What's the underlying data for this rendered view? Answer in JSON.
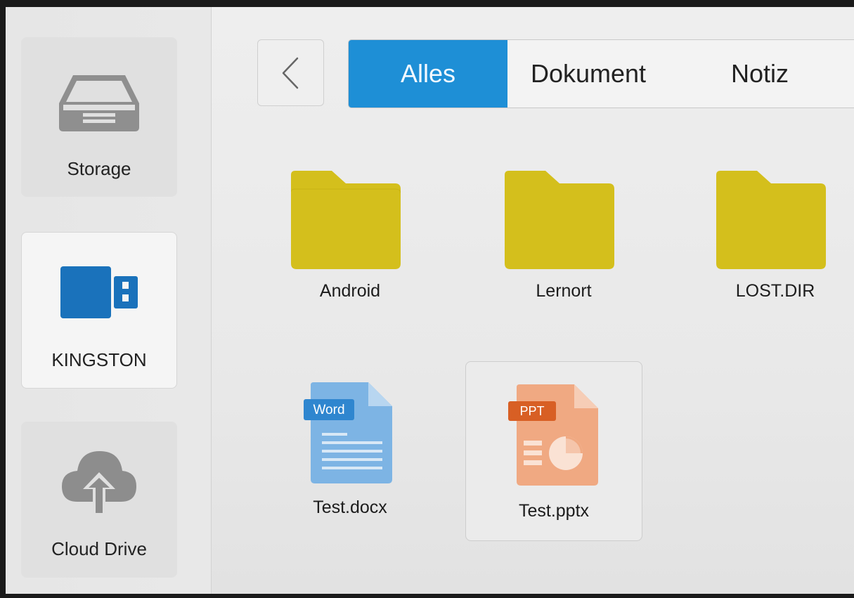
{
  "sidebar": {
    "items": [
      {
        "label": "Storage",
        "icon": "storage-tray-icon"
      },
      {
        "label": "KINGSTON",
        "icon": "usb-drive-icon"
      },
      {
        "label": "Cloud Drive",
        "icon": "cloud-upload-icon"
      }
    ]
  },
  "toolbar": {
    "back_icon": "chevron-left-icon"
  },
  "tabs": [
    {
      "label": "Alles",
      "active": true
    },
    {
      "label": "Dokument",
      "active": false
    },
    {
      "label": "Notiz",
      "active": false
    }
  ],
  "files": [
    {
      "name": "Android",
      "type": "folder"
    },
    {
      "name": "Lernort",
      "type": "folder"
    },
    {
      "name": "LOST.DIR",
      "type": "folder"
    },
    {
      "name": "Test.docx",
      "type": "word",
      "badge": "Word"
    },
    {
      "name": "Test.pptx",
      "type": "ppt",
      "badge": "PPT",
      "selected": true
    }
  ],
  "colors": {
    "accent": "#1e8fd6",
    "folder": "#d4bf1c",
    "word": "#7db4e4",
    "word_badge": "#2f86cf",
    "ppt": "#f0a982",
    "ppt_badge": "#d85f24",
    "usb": "#1a72bb"
  }
}
